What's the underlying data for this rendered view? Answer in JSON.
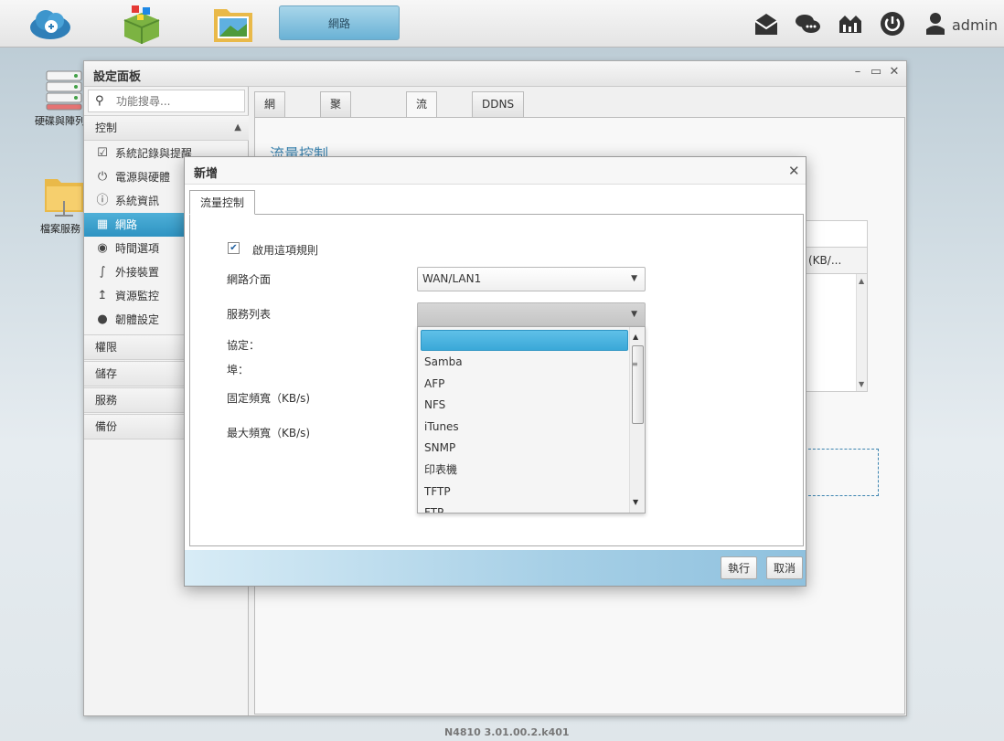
{
  "taskbar": {
    "active_tab": "網路",
    "user": "admin"
  },
  "desktop": {
    "icon1_label": "硬碟與陣列",
    "icon2_label": "檔案服務"
  },
  "window": {
    "title": "設定面板",
    "search_placeholder": "功能搜尋...",
    "sections": {
      "control": "控制",
      "permission": "權限",
      "storage": "儲存",
      "service": "服務",
      "backup": "備份"
    },
    "nav": [
      {
        "label": "系統記錄與提醒",
        "icon": "clipboard-icon"
      },
      {
        "label": "電源與硬體",
        "icon": "power-icon"
      },
      {
        "label": "系統資訊",
        "icon": "info-icon"
      },
      {
        "label": "網路",
        "icon": "network-icon"
      },
      {
        "label": "時間選項",
        "icon": "globe-icon"
      },
      {
        "label": "外接裝置",
        "icon": "usb-icon"
      },
      {
        "label": "資源監控",
        "icon": "chart-icon"
      },
      {
        "label": "韌體設定",
        "icon": "firmware-icon"
      }
    ],
    "tabs": [
      "網路設定",
      "聚合網路介面",
      "流量控制",
      "DDNS"
    ],
    "panel_title": "流量控制",
    "table_header_partial": "(KB/..."
  },
  "dialog": {
    "title": "新增",
    "tab": "流量控制",
    "enable_rule_label": "啟用這項規則",
    "enable_rule_checked": true,
    "net_interface_label": "網路介面",
    "net_interface_value": "WAN/LAN1",
    "service_list_label": "服務列表",
    "service_list_value": "",
    "protocol_label": "協定：",
    "port_label": "埠：",
    "fixed_bw_label": "固定頻寬（KB/s)",
    "max_bw_label": "最大頻寬（KB/s)",
    "dropdown_options": [
      "Samba",
      "AFP",
      "NFS",
      "iTunes",
      "SNMP",
      "印表機",
      "TFTP",
      "FTP"
    ],
    "execute_button": "執行",
    "cancel_button": "取消"
  },
  "footer": {
    "version": "N4810   3.01.00.2.k401"
  },
  "colors": {
    "accent": "#3aa8d8",
    "title_blue": "#3c84b0"
  }
}
